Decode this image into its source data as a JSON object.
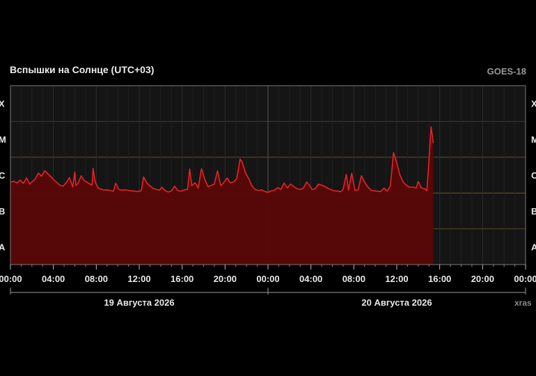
{
  "chart_data": {
    "type": "area",
    "title": "Вспышки на Солнце (UTC+03)",
    "source_label": "GOES-18",
    "watermark": "xras",
    "x_unit": "hours since 19 Aug 2026 00:00 (UTC+03)",
    "xlim": [
      0,
      48
    ],
    "x_tick_labels": [
      "00:00",
      "04:00",
      "08:00",
      "12:00",
      "16:00",
      "20:00",
      "00:00",
      "04:00",
      "08:00",
      "12:00",
      "16:00",
      "20:00",
      "00:00"
    ],
    "x_tick_values": [
      0,
      4,
      8,
      12,
      16,
      20,
      24,
      28,
      32,
      36,
      40,
      44,
      48
    ],
    "date_labels": [
      {
        "label": "19 Августа 2026",
        "start": 0,
        "end": 24
      },
      {
        "label": "20 Августа 2026",
        "start": 24,
        "end": 48
      }
    ],
    "y_scale": "log (flare class)",
    "y_class_labels": [
      "X",
      "M",
      "C",
      "B",
      "A"
    ],
    "ylim_class_units": [
      0,
      5
    ],
    "series": [
      {
        "color": "#e8232a",
        "x": [
          0,
          0.3,
          0.6,
          0.9,
          1.2,
          1.5,
          1.8,
          2.0,
          2.3,
          2.6,
          2.9,
          3.2,
          3.5,
          3.8,
          4.0,
          4.3,
          4.6,
          4.9,
          5.2,
          5.5,
          5.8,
          6.0,
          6.1,
          6.3,
          6.6,
          6.9,
          7.1,
          7.4,
          7.6,
          7.7,
          7.9,
          8.2,
          8.5,
          8.8,
          9.0,
          9.3,
          9.6,
          9.8,
          10.1,
          10.4,
          10.7,
          11.0,
          11.3,
          11.6,
          11.9,
          12.2,
          12.4,
          12.7,
          13.0,
          13.3,
          13.6,
          13.9,
          14.1,
          14.4,
          14.7,
          15.0,
          15.3,
          15.6,
          15.9,
          16.2,
          16.5,
          16.7,
          16.9,
          17.2,
          17.5,
          17.8,
          18.1,
          18.4,
          18.7,
          19.0,
          19.3,
          19.6,
          19.9,
          20.2,
          20.5,
          20.8,
          21.1,
          21.4,
          21.6,
          21.9,
          22.2,
          22.5,
          22.8,
          23.1,
          23.4,
          23.7,
          24.0,
          24.3,
          24.6,
          24.9,
          25.2,
          25.5,
          25.8,
          26.1,
          26.4,
          26.7,
          27.0,
          27.3,
          27.6,
          27.9,
          28.1,
          28.4,
          28.7,
          29.0,
          29.3,
          29.6,
          29.9,
          30.2,
          30.5,
          30.8,
          31.0,
          31.3,
          31.5,
          31.8,
          32.1,
          32.4,
          32.7,
          33.0,
          33.3,
          33.6,
          33.9,
          34.2,
          34.5,
          34.8,
          35.1,
          35.4,
          35.7,
          36.0,
          36.3,
          36.6,
          36.9,
          37.2,
          37.5,
          37.8,
          38.0,
          38.3,
          38.6,
          38.8,
          39.0,
          39.2,
          39.4
        ],
        "y_class_units": [
          2.3,
          2.33,
          2.28,
          2.36,
          2.27,
          2.42,
          2.25,
          2.31,
          2.39,
          2.56,
          2.47,
          2.62,
          2.53,
          2.45,
          2.38,
          2.3,
          2.22,
          2.19,
          2.29,
          2.43,
          2.17,
          2.59,
          2.21,
          2.27,
          2.48,
          2.34,
          2.31,
          2.25,
          2.22,
          2.69,
          2.3,
          2.14,
          2.1,
          2.08,
          2.09,
          2.07,
          2.05,
          2.27,
          2.1,
          2.08,
          2.09,
          2.07,
          2.06,
          2.05,
          2.04,
          2.07,
          2.45,
          2.29,
          2.2,
          2.13,
          2.1,
          2.08,
          2.16,
          2.07,
          2.03,
          2.06,
          2.19,
          2.07,
          2.05,
          2.09,
          2.1,
          2.67,
          2.2,
          2.29,
          2.14,
          2.68,
          2.39,
          2.18,
          2.21,
          2.25,
          2.62,
          2.2,
          2.3,
          2.42,
          2.28,
          2.31,
          2.41,
          2.95,
          2.86,
          2.57,
          2.4,
          2.2,
          2.1,
          2.07,
          2.09,
          2.04,
          2.02,
          2.06,
          2.08,
          2.15,
          2.1,
          2.28,
          2.14,
          2.25,
          2.18,
          2.12,
          2.1,
          2.14,
          2.31,
          2.2,
          2.1,
          2.12,
          2.25,
          2.22,
          2.18,
          2.13,
          2.09,
          2.06,
          2.05,
          2.04,
          2.1,
          2.52,
          2.08,
          2.55,
          2.07,
          2.09,
          2.48,
          2.3,
          2.17,
          2.08,
          2.06,
          2.05,
          2.04,
          2.14,
          2.05,
          2.2,
          3.13,
          2.83,
          2.5,
          2.3,
          2.22,
          2.16,
          2.17,
          2.14,
          2.32,
          2.14,
          2.12,
          2.06,
          2.93,
          3.85,
          3.4,
          2.88
        ]
      }
    ],
    "grid": true,
    "legend": "none"
  }
}
